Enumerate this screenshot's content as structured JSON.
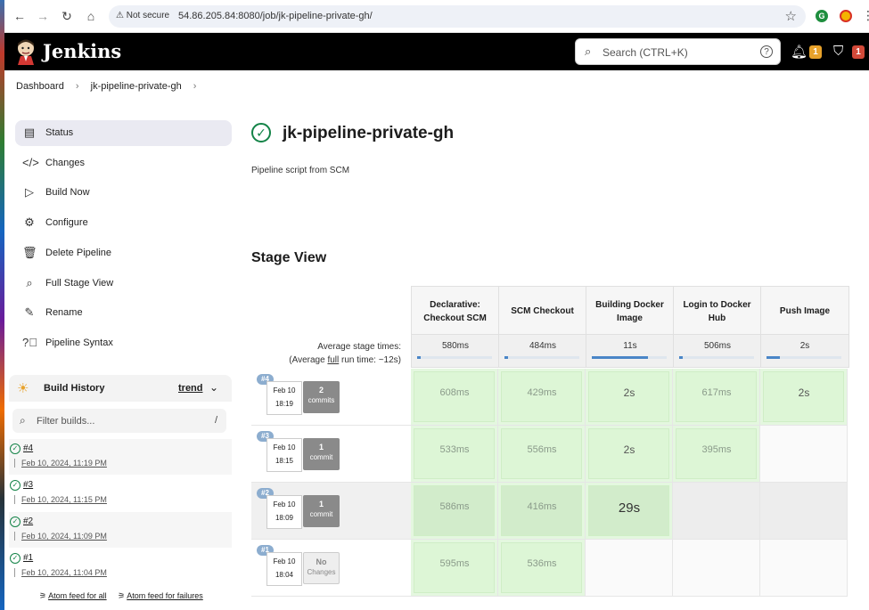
{
  "browser": {
    "security_label": "Not secure",
    "url": "54.86.205.84:8080/job/jk-pipeline-private-gh/"
  },
  "header": {
    "logo_text": "Jenkins",
    "search_placeholder": "Search (CTRL+K)",
    "help_glyph": "?",
    "notifications_count": "1",
    "security_count": "1",
    "notification_color": "#e8a22b",
    "security_color": "#d24939"
  },
  "breadcrumb": {
    "items": [
      "Dashboard",
      "jk-pipeline-private-gh"
    ]
  },
  "sidebar": {
    "items": [
      {
        "label": "Status",
        "icon": "document-icon"
      },
      {
        "label": "Changes",
        "icon": "code-icon"
      },
      {
        "label": "Build Now",
        "icon": "play-icon"
      },
      {
        "label": "Configure",
        "icon": "gear-icon"
      },
      {
        "label": "Delete Pipeline",
        "icon": "trash-icon"
      },
      {
        "label": "Full Stage View",
        "icon": "search-icon"
      },
      {
        "label": "Rename",
        "icon": "pencil-icon"
      },
      {
        "label": "Pipeline Syntax",
        "icon": "help-icon"
      }
    ]
  },
  "build_history": {
    "title": "Build History",
    "trend_label": "trend",
    "filter_placeholder": "Filter builds...",
    "filter_shortcut": "/",
    "builds": [
      {
        "number": "#4",
        "date": "Feb 10, 2024, 11:19 PM"
      },
      {
        "number": "#3",
        "date": "Feb 10, 2024, 11:15 PM"
      },
      {
        "number": "#2",
        "date": "Feb 10, 2024, 11:09 PM"
      },
      {
        "number": "#1",
        "date": "Feb 10, 2024, 11:04 PM"
      }
    ],
    "feed_all": "Atom feed for all",
    "feed_failures": "Atom feed for failures"
  },
  "main": {
    "job_title": "jk-pipeline-private-gh",
    "description": "Pipeline script from SCM",
    "stage_view_title": "Stage View"
  },
  "stage_view": {
    "stages": [
      "Declarative: Checkout SCM",
      "SCM Checkout",
      "Building Docker Image",
      "Login to Docker Hub",
      "Push Image"
    ],
    "avg_label": "Average stage times:",
    "avg_full_prefix": "(Average ",
    "avg_full_link": "full",
    "avg_full_suffix": " run time: ~12s)",
    "avg_times": [
      "580ms",
      "484ms",
      "11s",
      "506ms",
      "2s"
    ],
    "avg_fill_fraction": [
      0.05,
      0.05,
      0.75,
      0.05,
      0.18
    ],
    "runs": [
      {
        "badge": "#4",
        "date": "Feb 10",
        "time": "18:19",
        "commits_count": "2",
        "commits_label": "commits",
        "times": [
          "608ms",
          "429ms",
          "2s",
          "617ms",
          "2s"
        ]
      },
      {
        "badge": "#3",
        "date": "Feb 10",
        "time": "18:15",
        "commits_count": "1",
        "commits_label": "commit",
        "times": [
          "533ms",
          "556ms",
          "2s",
          "395ms",
          ""
        ]
      },
      {
        "badge": "#2",
        "date": "Feb 10",
        "time": "18:09",
        "commits_count": "1",
        "commits_label": "commit",
        "times": [
          "586ms",
          "416ms",
          "29s",
          "",
          ""
        ]
      },
      {
        "badge": "#1",
        "date": "Feb 10",
        "time": "18:04",
        "commits_count": "No",
        "commits_label": "Changes",
        "times": [
          "595ms",
          "536ms",
          "",
          "",
          ""
        ]
      }
    ]
  }
}
